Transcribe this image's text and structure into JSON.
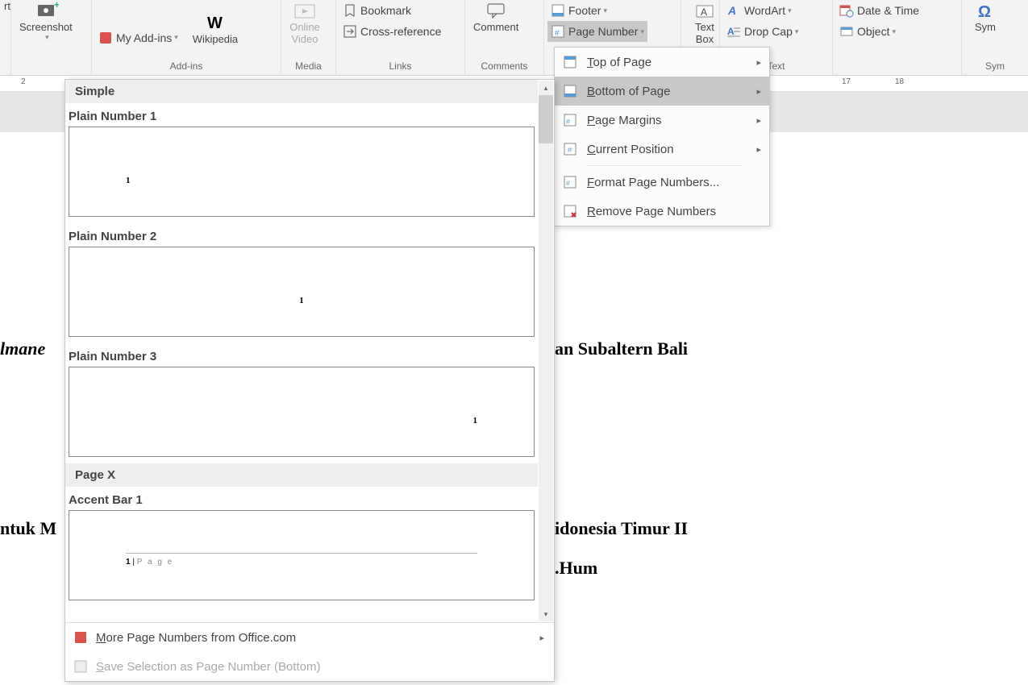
{
  "ribbon": {
    "chart_btn": "rt",
    "screenshot": "Screenshot",
    "my_addins": "My Add-ins",
    "wikipedia": "Wikipedia",
    "addins_group": "Add-ins",
    "online_video": {
      "l1": "Online",
      "l2": "Video"
    },
    "media_group": "Media",
    "bookmark": "Bookmark",
    "cross_reference": "Cross-reference",
    "links_group": "Links",
    "comment": "Comment",
    "comments_group": "Comments",
    "footer": "Footer",
    "page_number": "Page Number",
    "text_box": {
      "l1": "Text",
      "l2": "Box"
    },
    "wordart": "WordArt",
    "drop_cap": "Drop Cap",
    "text_group": "Text",
    "date_time": "Date & Time",
    "object": "Object",
    "symbol": "Sym",
    "symbols_group": "Sym"
  },
  "ruler": {
    "left": "2",
    "r17": "17",
    "r18": "18"
  },
  "submenu": {
    "top_of_page": "Top of Page",
    "bottom_of_page": "Bottom of Page",
    "page_margins": "Page Margins",
    "current_position": "Current Position",
    "format": "Format Page Numbers...",
    "remove": "Remove Page Numbers"
  },
  "gallery": {
    "simple": "Simple",
    "plain1": "Plain Number 1",
    "plain2": "Plain Number 2",
    "plain3": "Plain Number 3",
    "page_x": "Page X",
    "accent1": "Accent Bar 1",
    "accent_text": "1 | P a g e",
    "more": "More Page Numbers from Office.com",
    "save_sel": "Save Selection as Page Number (Bottom)",
    "preview_num": "1"
  },
  "doc": {
    "t1": "lmane",
    "t2": "an Subaltern Bali",
    "t3": "ntuk M",
    "t4": "idonesia Timur II",
    "t5": ".Hum"
  }
}
